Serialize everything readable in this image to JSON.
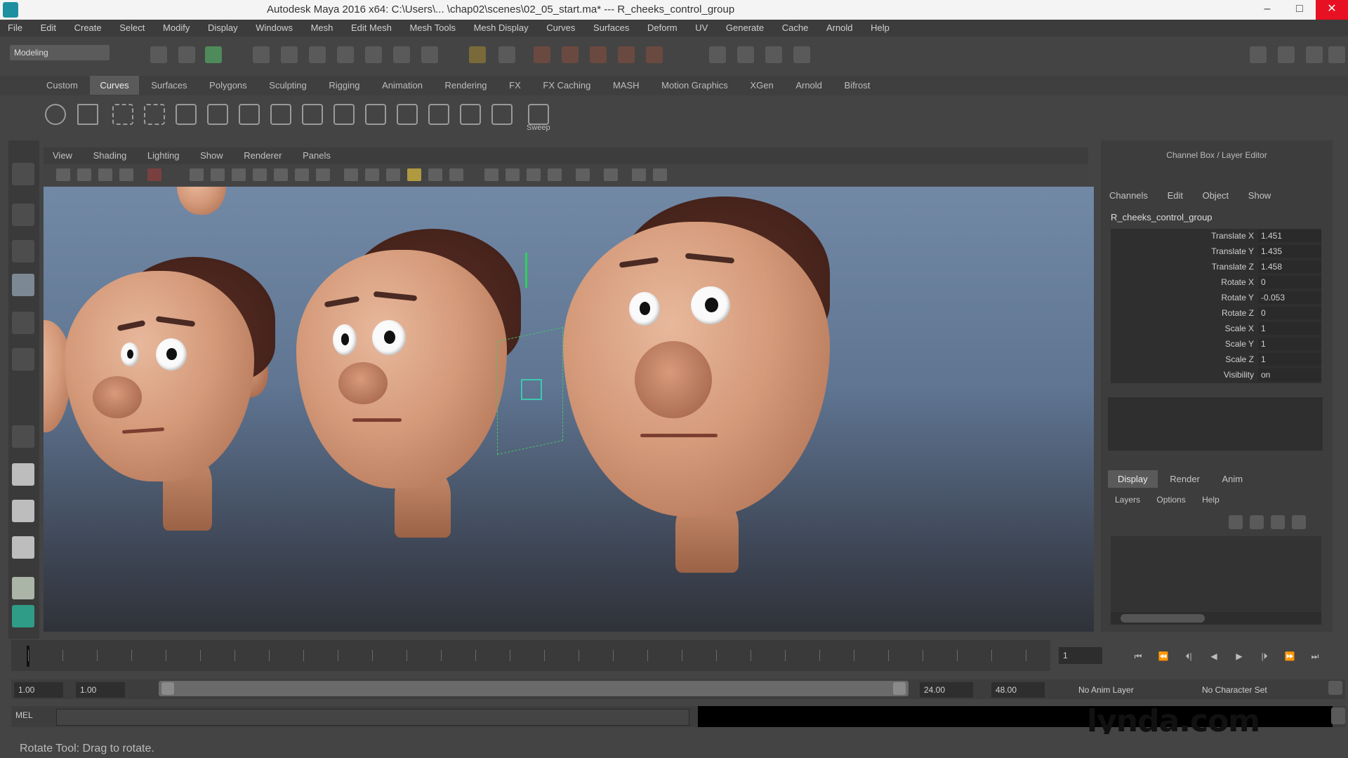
{
  "window": {
    "title": "Autodesk Maya 2016 x64: C:\\Users\\... \\chap02\\scenes\\02_05_start.ma* --- R_cheeks_control_group",
    "controls": [
      "–",
      "□",
      "✕"
    ]
  },
  "menubar": {
    "items": [
      "File",
      "Edit",
      "Create",
      "Select",
      "Modify",
      "Display",
      "Windows",
      "Mesh",
      "Edit Mesh",
      "Mesh Tools",
      "Mesh Display",
      "Curves",
      "Surfaces",
      "Deform",
      "UV",
      "Generate",
      "Cache",
      "Arnold",
      "Help"
    ]
  },
  "statusline": {
    "mode": "Modeling"
  },
  "shelf": {
    "tabs": [
      "Custom",
      "Curves",
      "Surfaces",
      "Polygons",
      "Sculpting",
      "Rigging",
      "Animation",
      "Rendering",
      "FX",
      "FX Caching",
      "MASH",
      "Motion Graphics",
      "XGen",
      "Arnold",
      "Bifrost"
    ],
    "active_tab": "Curves",
    "last_icon_label": "Sweep"
  },
  "viewport": {
    "menu": [
      "View",
      "Shading",
      "Lighting",
      "Show",
      "Renderer",
      "Panels"
    ]
  },
  "channel_box": {
    "title": "Channel Box / Layer Editor",
    "menu": [
      "Channels",
      "Edit",
      "Object",
      "Show"
    ],
    "object_name": "R_cheeks_control_group",
    "attributes": [
      {
        "name": "Translate X",
        "value": "1.451"
      },
      {
        "name": "Translate Y",
        "value": "1.435"
      },
      {
        "name": "Translate Z",
        "value": "1.458"
      },
      {
        "name": "Rotate X",
        "value": "0"
      },
      {
        "name": "Rotate Y",
        "value": "-0.053"
      },
      {
        "name": "Rotate Z",
        "value": "0"
      },
      {
        "name": "Scale X",
        "value": "1"
      },
      {
        "name": "Scale Y",
        "value": "1"
      },
      {
        "name": "Scale Z",
        "value": "1"
      },
      {
        "name": "Visibility",
        "value": "on"
      }
    ]
  },
  "layer_editor": {
    "tabs": [
      "Display",
      "Render",
      "Anim"
    ],
    "active_tab": "Display",
    "menu": [
      "Layers",
      "Options",
      "Help"
    ]
  },
  "time_slider": {
    "current_frame": "1",
    "playback_buttons": [
      "⏮",
      "⏪",
      "⏴|",
      "◀",
      "▶",
      "|⏵",
      "⏩",
      "⏭"
    ]
  },
  "range_slider": {
    "start": "1.00",
    "inner_start": "1.00",
    "inner_end": "24.00",
    "end": "48.00",
    "character_set": "No Character Set",
    "anim_layer": "No Anim Layer"
  },
  "command_line": {
    "label": "MEL"
  },
  "help_line": {
    "text": "Rotate Tool: Drag to rotate."
  },
  "watermark": {
    "text": "lynda.com"
  },
  "colors": {
    "viewport_top": "#7289a6",
    "viewport_bottom": "#2f3238",
    "close_button": "#e81123",
    "manipulator": "#2fd15a"
  }
}
